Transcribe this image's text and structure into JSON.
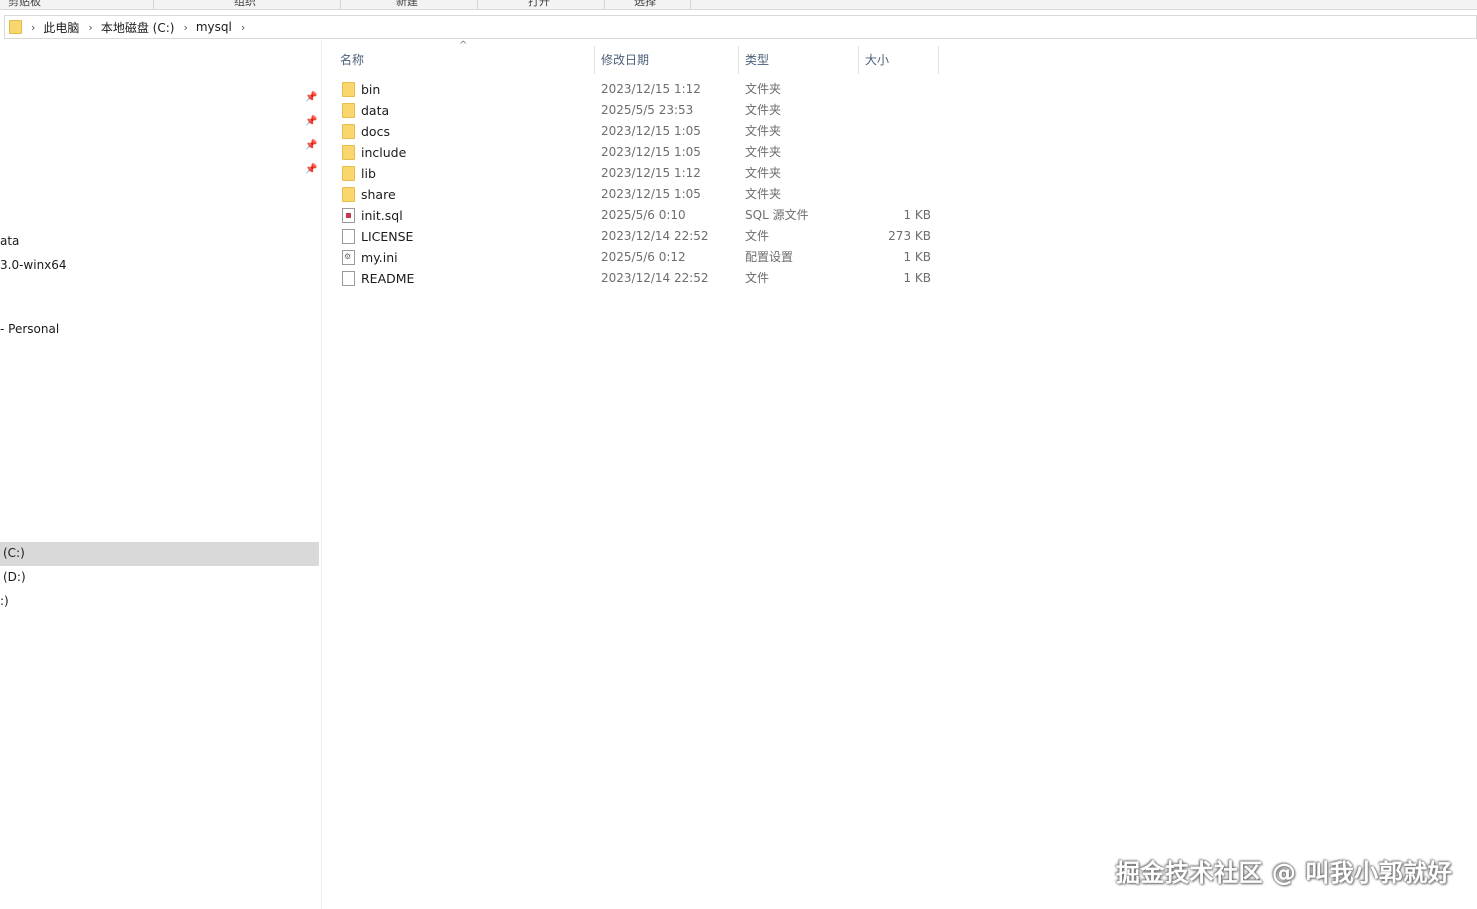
{
  "ribbon": {
    "groups": [
      "剪贴板",
      "组织",
      "新建",
      "打开",
      "选择"
    ]
  },
  "address_bar": {
    "crumbs": [
      "此电脑",
      "本地磁盘 (C:)",
      "mysql"
    ]
  },
  "nav_pane": {
    "items": [
      "ata",
      "3.0-winx64",
      "- Personal",
      "(C:)",
      "(D:)",
      ":)"
    ],
    "selected": "(C:)"
  },
  "columns": {
    "name": "名称",
    "date": "修改日期",
    "type": "类型",
    "size": "大小"
  },
  "files": [
    {
      "name": "bin",
      "date": "2023/12/15 1:12",
      "type": "文件夹",
      "size": "",
      "icon": "folder-icon"
    },
    {
      "name": "data",
      "date": "2025/5/5 23:53",
      "type": "文件夹",
      "size": "",
      "icon": "folder-icon"
    },
    {
      "name": "docs",
      "date": "2023/12/15 1:05",
      "type": "文件夹",
      "size": "",
      "icon": "folder-icon"
    },
    {
      "name": "include",
      "date": "2023/12/15 1:05",
      "type": "文件夹",
      "size": "",
      "icon": "folder-icon"
    },
    {
      "name": "lib",
      "date": "2023/12/15 1:12",
      "type": "文件夹",
      "size": "",
      "icon": "folder-icon"
    },
    {
      "name": "share",
      "date": "2023/12/15 1:05",
      "type": "文件夹",
      "size": "",
      "icon": "folder-icon"
    },
    {
      "name": "init.sql",
      "date": "2025/5/6 0:10",
      "type": "SQL 源文件",
      "size": "1 KB",
      "icon": "sql-file-icon"
    },
    {
      "name": "LICENSE",
      "date": "2023/12/14 22:52",
      "type": "文件",
      "size": "273 KB",
      "icon": "file-icon"
    },
    {
      "name": "my.ini",
      "date": "2025/5/6 0:12",
      "type": "配置设置",
      "size": "1 KB",
      "icon": "ini-file-icon"
    },
    {
      "name": "README",
      "date": "2023/12/14 22:52",
      "type": "文件",
      "size": "1 KB",
      "icon": "file-icon"
    }
  ],
  "watermark": "掘金技术社区 @ 叫我小郭就好"
}
